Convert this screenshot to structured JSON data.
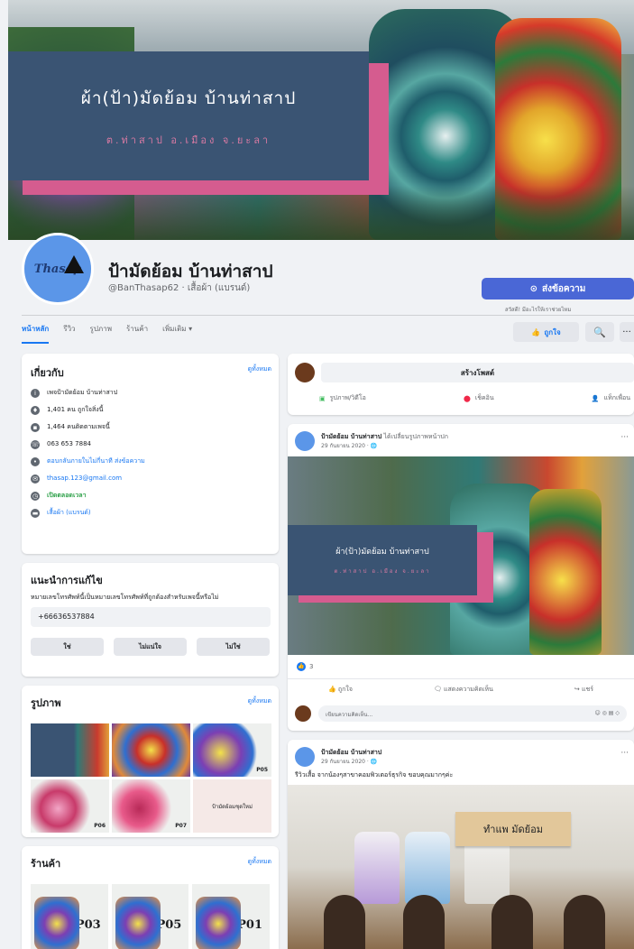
{
  "cover": {
    "title": "ผ้า(ป้า)มัดย้อม บ้านท่าสาป",
    "subtitle": "ต.ท่าสาป อ.เมือง จ.ยะลา"
  },
  "profile": {
    "logo_text": "Thasap",
    "name": "ป้ามัดย้อม บ้านท่าสาป",
    "handle": "@BanThasap62 · เสื้อผ้า (แบรนด์)",
    "message_button": "ส่งข้อความ",
    "message_sub": "สวัสดี! มีอะไรให้เราช่วยไหม"
  },
  "tabs": [
    "หน้าหลัก",
    "รีวิว",
    "รูปภาพ",
    "ร้านค้า",
    "เพิ่มเติม ▾"
  ],
  "actions": {
    "like": "ถูกใจ",
    "search_icon": "🔍",
    "more": "···"
  },
  "about": {
    "title": "เกี่ยวกับ",
    "see_all": "ดูทั้งหมด",
    "rows": [
      "เพจป้ามัดย้อม บ้านท่าสาป",
      "1,401 คน ถูกใจสิ่งนี้",
      "1,464 คนติดตามเพจนี้",
      "063 653 7884",
      "ตอบกลับภายในไม่กี่นาที ส่งข้อความ",
      "thasap.123@gmail.com",
      "เปิดตลอดเวลา",
      "เสื้อผ้า (แบรนด์)"
    ]
  },
  "suggest": {
    "title": "แนะนำการแก้ไข",
    "desc": "หมายเลขโทรศัพท์นี้เป็นหมายเลขโทรศัพท์ที่ถูกต้องสำหรับเพจนี้หรือไม่",
    "phone": "+66636537884",
    "yes": "ใช่",
    "unsure": "ไม่แน่ใจ",
    "no": "ไม่ใช่"
  },
  "photos": {
    "title": "รูปภาพ",
    "see_all": "ดูทั้งหมด",
    "labels": [
      "",
      "",
      "P05",
      "P06",
      "P07",
      "ป้ามัดย้อมชุดใหม่"
    ]
  },
  "shop": {
    "title": "ร้านค้า",
    "see_all": "ดูทั้งหมด",
    "items": [
      "P03",
      "P05",
      "P01"
    ]
  },
  "create": {
    "title": "สร้างโพสต์",
    "photo": "รูปภาพ/วิดีโอ",
    "checkin": "เช็คอิน",
    "tag": "แท็กเพื่อน"
  },
  "post1": {
    "author": "ป้ามัดย้อม บ้านท่าสาป",
    "action": " ได้เปลี่ยนรูปภาพหน้าปก",
    "date": "29 กันยายน 2020 · 🌐",
    "img_title": "ผ้า(ป้า)มัดย้อม บ้านท่าสาป",
    "img_sub": "ต.ท่าสาป อ.เมือง จ.ยะลา",
    "reactions": "3",
    "like": "ถูกใจ",
    "comment": "แสดงความคิดเห็น",
    "share": "แชร์",
    "comment_placeholder": "เขียนความคิดเห็น...",
    "comment_icons": "☺ ◎ ▤ ◇"
  },
  "post2": {
    "author": "ป้ามัดย้อม บ้านท่าสาป",
    "date": "29 กันยายน 2020 · 🌐",
    "caption": "รีวิวเสื้อ จากน้องๆสาขาคอมพิวเตอร์ธุรกิจ ขอบคุณมากๆค่ะ",
    "sign": "ทำแพ มัดย้อม"
  }
}
